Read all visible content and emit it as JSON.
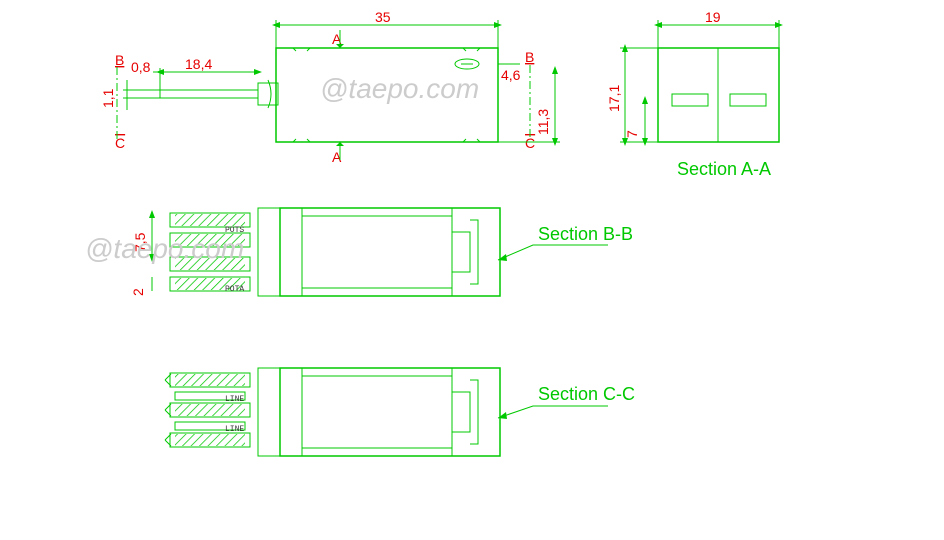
{
  "dimensions": {
    "d35": "35",
    "d19": "19",
    "d18_4": "18,4",
    "d0_8": "0,8",
    "d1_1": "1,1",
    "d4_6": "4,6",
    "d11_3": "11,3",
    "d17_1": "17,1",
    "d7": "7",
    "d7_5": "7,5",
    "d2": "2"
  },
  "markers": {
    "b_top": "B",
    "c_bot": "C",
    "a_top": "A",
    "a_bot": "A",
    "b_right": "B",
    "c_right": "C"
  },
  "sections": {
    "aa": "Section A-A",
    "bb": "Section B-B",
    "cc": "Section C-C"
  },
  "pin_labels": {
    "pots": "POTS",
    "pota": "POTA",
    "line": "LINE"
  },
  "watermark": "@taepo.com"
}
